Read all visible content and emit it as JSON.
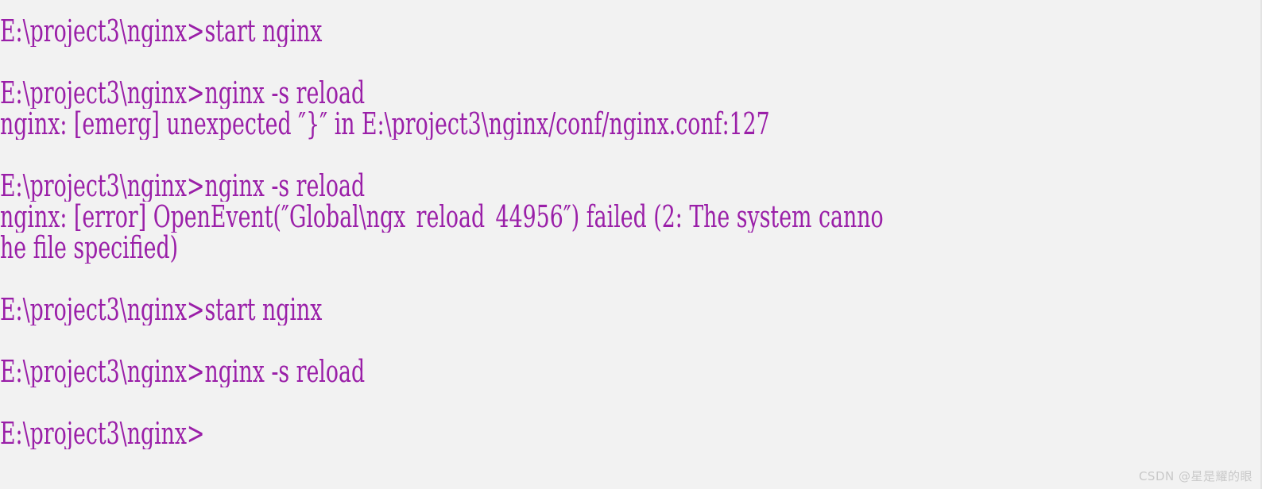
{
  "window": {
    "title": "Command Prompt - nginx",
    "background_color": "#f2f2f2",
    "text_color": "#9a1fa8",
    "prompt": "E:\\project3\\nginx>"
  },
  "console": {
    "lines": [
      {
        "id": "cmd-start-nginx-1",
        "type": "command",
        "text": "E:\\project3\\nginx>start nginx"
      },
      {
        "id": "blank-1",
        "type": "blank",
        "text": ""
      },
      {
        "id": "cmd-reload-1",
        "type": "command",
        "text": "E:\\project3\\nginx>nginx -s reload"
      },
      {
        "id": "err-emerg",
        "type": "error",
        "text": "nginx: [emerg] unexpected ″}″ in E:\\project3\\nginx/conf/nginx.conf:127"
      },
      {
        "id": "blank-2",
        "type": "blank",
        "text": ""
      },
      {
        "id": "cmd-reload-2",
        "type": "command",
        "text": "E:\\project3\\nginx>nginx -s reload"
      },
      {
        "id": "err-openevent",
        "type": "error",
        "text": "nginx: [error] OpenEvent(″Global\\ngx_reload_44956″) failed (2: The system canno"
      },
      {
        "id": "err-openevent-wrap",
        "type": "error",
        "text": "he file specified)"
      },
      {
        "id": "blank-3",
        "type": "blank",
        "text": ""
      },
      {
        "id": "cmd-start-nginx-2",
        "type": "command",
        "text": "E:\\project3\\nginx>start nginx"
      },
      {
        "id": "blank-4",
        "type": "blank",
        "text": ""
      },
      {
        "id": "cmd-reload-3",
        "type": "command",
        "text": "E:\\project3\\nginx>nginx -s reload"
      },
      {
        "id": "blank-5",
        "type": "blank",
        "text": ""
      },
      {
        "id": "cmd-prompt-final",
        "type": "prompt",
        "text": "E:\\project3\\nginx>"
      }
    ]
  },
  "watermark": {
    "text": "CSDN @星是耀的眼",
    "color": "#c9c9c9"
  }
}
